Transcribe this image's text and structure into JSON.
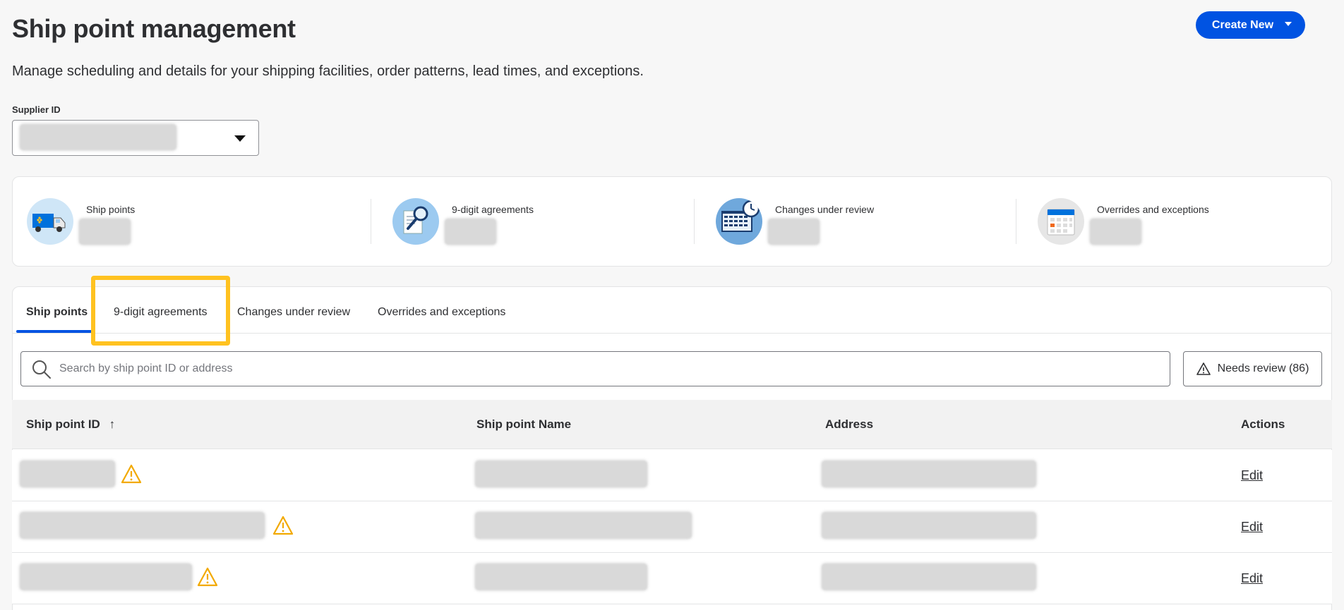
{
  "header": {
    "title": "Ship point management",
    "create_label": "Create New",
    "subtitle": "Manage scheduling and details for your shipping facilities, order patterns, lead times, and exceptions."
  },
  "supplier": {
    "label": "Supplier ID"
  },
  "summary": {
    "items": [
      {
        "label": "Ship points",
        "icon": "delivery-truck-icon"
      },
      {
        "label": "9-digit agreements",
        "icon": "magnifier-document-icon"
      },
      {
        "label": "Changes under review",
        "icon": "calendar-clock-icon"
      },
      {
        "label": "Overrides and exceptions",
        "icon": "calendar-icon"
      }
    ]
  },
  "tabs": [
    {
      "label": "Ship points",
      "active": true
    },
    {
      "label": "9-digit agreements",
      "active": false
    },
    {
      "label": "Changes under review",
      "active": false
    },
    {
      "label": "Overrides and exceptions",
      "active": false
    }
  ],
  "search": {
    "placeholder": "Search by ship point ID or address"
  },
  "needs_review": {
    "label": "Needs review (86)"
  },
  "table": {
    "columns": [
      "Ship point ID",
      "Ship point Name",
      "Address",
      "Actions"
    ],
    "sort_indicator": "↑",
    "row_action": "Edit",
    "rows": 3
  },
  "colors": {
    "primary": "#0053e2",
    "highlight": "#ffc220",
    "warning": "#f2a900"
  }
}
